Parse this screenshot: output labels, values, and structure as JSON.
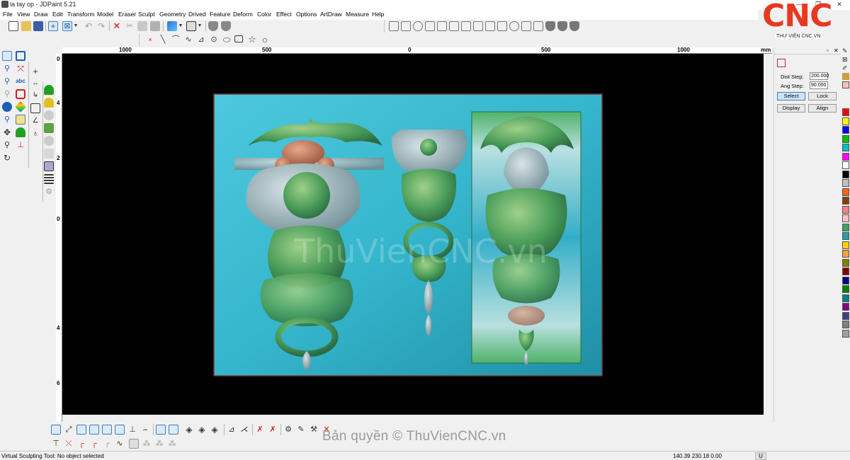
{
  "window": {
    "title": "la tay  op - JDPaint 5.21",
    "min_symbol": "—",
    "max_symbol": "❐",
    "close_symbol": "✕"
  },
  "menu": [
    "File",
    "View",
    "Draw",
    "Edit",
    "Transform",
    "Model",
    "Eraser",
    "Sculpt",
    "Geometry",
    "Drived",
    "Feature",
    "Deform",
    "Color",
    "Effect",
    "Options",
    "ArtDraw",
    "Measure",
    "Help"
  ],
  "ruler": {
    "unit": "mm",
    "h_labels": [
      "1000",
      "500",
      "0",
      "500",
      "1000"
    ],
    "v_labels": [
      "0",
      "4",
      "2",
      "0",
      "4",
      "6"
    ]
  },
  "canvas": {
    "watermark": "ThuVienCNC.vn"
  },
  "panel": {
    "dist_step_label": "Dist Step:",
    "dist_step_value": "200.000",
    "ang_step_label": "Ang Step:",
    "ang_step_value": "90.000",
    "buttons": [
      "Select",
      "Lock",
      "Display",
      "Align"
    ],
    "active_button": "Select"
  },
  "palette": [
    "#ff0000",
    "#ffff00",
    "#0000ff",
    "#00c000",
    "#00c0c0",
    "#ff00ff",
    "#ffffff",
    "#000000",
    "#c0c0c0",
    "#ff6020",
    "#804000",
    "#ff8080",
    "#ffc0c0",
    "#40a060",
    "#20a0a0",
    "#ffd000",
    "#ffa040",
    "#808000",
    "#800000",
    "#000080",
    "#008000",
    "#008080",
    "#800080",
    "#404080",
    "#808080",
    "#a0a0a0"
  ],
  "logo": {
    "brand": "CNC",
    "tagline": "THƯ VIỆN CNC.VN"
  },
  "watermark_bottom": "Bản quyền © ThuVienCNC.vn",
  "status": {
    "message": "Virtual Sculpting Tool: No object selected",
    "coords": "140.39 230.18 0.00",
    "unit_flag": "U"
  }
}
